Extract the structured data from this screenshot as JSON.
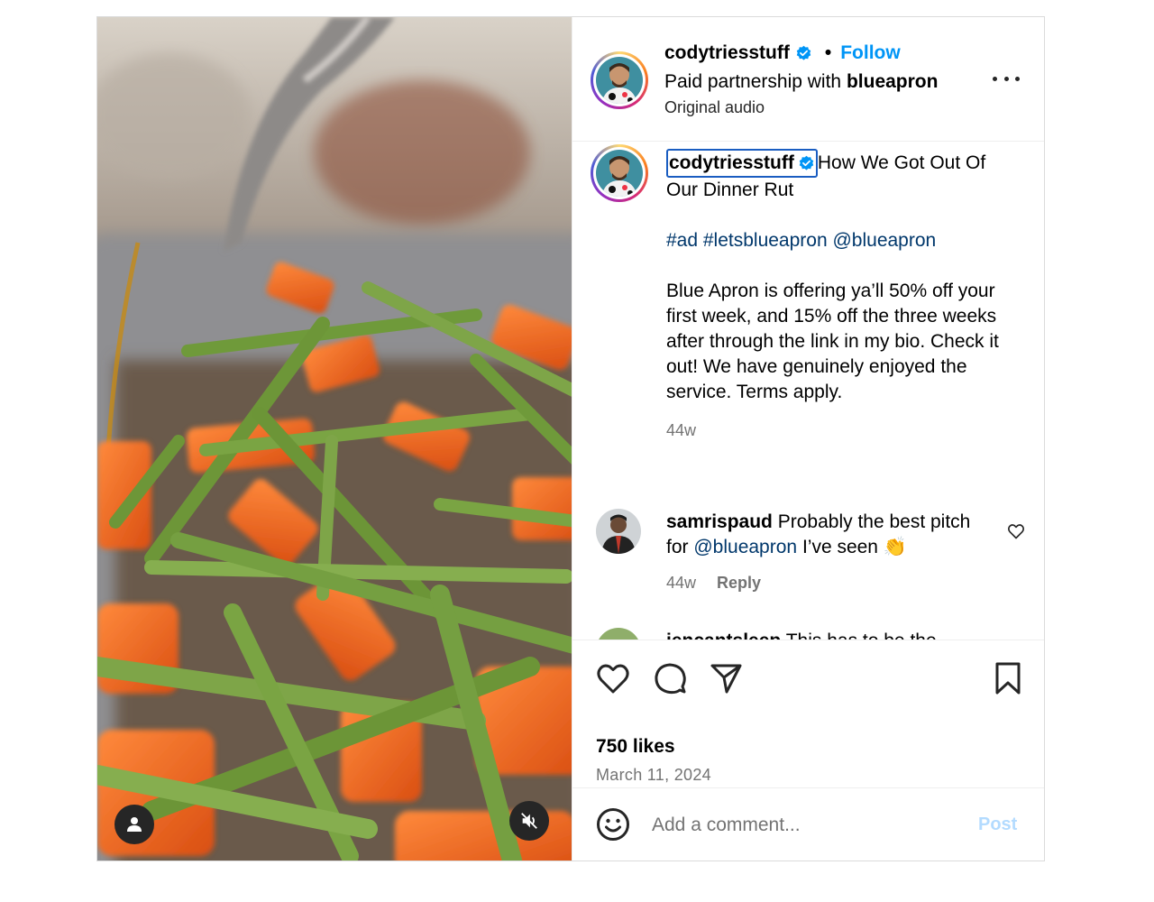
{
  "header": {
    "username": "codytriesstuff",
    "separator": "•",
    "follow_label": "Follow",
    "partnership_prefix": "Paid partnership with",
    "partner": "blueapron",
    "audio": "Original audio",
    "avatar_icon": "profile-avatar",
    "verified_icon": "verified-badge-icon",
    "more_icon": "more-options-icon"
  },
  "caption": {
    "username": "codytriesstuff",
    "title_line": "How We Got Out Of Our Dinner Rut",
    "hashtags": "#ad #letsblueapron @blueapron",
    "body": "Blue Apron is offering ya’ll 50% off your first week, and 15% off the three weeks after through the link in my bio. Check it out! We have genuinely enjoyed the service. Terms apply.",
    "time": "44w"
  },
  "comments": [
    {
      "username": "samrispaud",
      "text_before": "Probably the best pitch for",
      "mention": "@blueapron",
      "text_after": "I’ve seen 👏",
      "time": "44w",
      "reply_label": "Reply"
    },
    {
      "username": "jencantsleep",
      "text": "This has to be the"
    }
  ],
  "actions": {
    "like_icon": "heart-icon",
    "comment_icon": "comment-icon",
    "share_icon": "share-icon",
    "save_icon": "bookmark-icon"
  },
  "likes": "750 likes",
  "date": "March 11, 2024",
  "add_comment": {
    "placeholder": "Add a comment...",
    "post_label": "Post"
  },
  "media": {
    "tag_icon": "user-tag-icon",
    "mute_icon": "muted-speaker-icon"
  },
  "colors": {
    "accent": "#0095f6",
    "link": "#00376b",
    "secondary_text": "#737373",
    "post_disabled": "#b3dbff"
  }
}
